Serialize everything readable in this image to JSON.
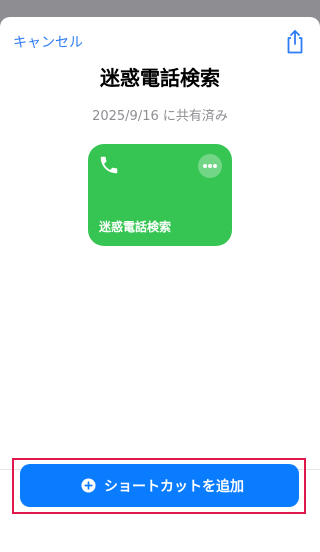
{
  "header": {
    "cancel_label": "キャンセル",
    "share_icon": "share-icon"
  },
  "shortcut": {
    "title": "迷惑電話検索",
    "shared_date": "2025/9/16 に共有済み",
    "tile_label": "迷惑電話検索",
    "tile_icon": "phone-icon",
    "tile_color": "#36c552"
  },
  "footer": {
    "add_button_label": "ショートカットを追加",
    "add_button_color": "#0a7cff",
    "highlight_color": "#e0184b"
  }
}
